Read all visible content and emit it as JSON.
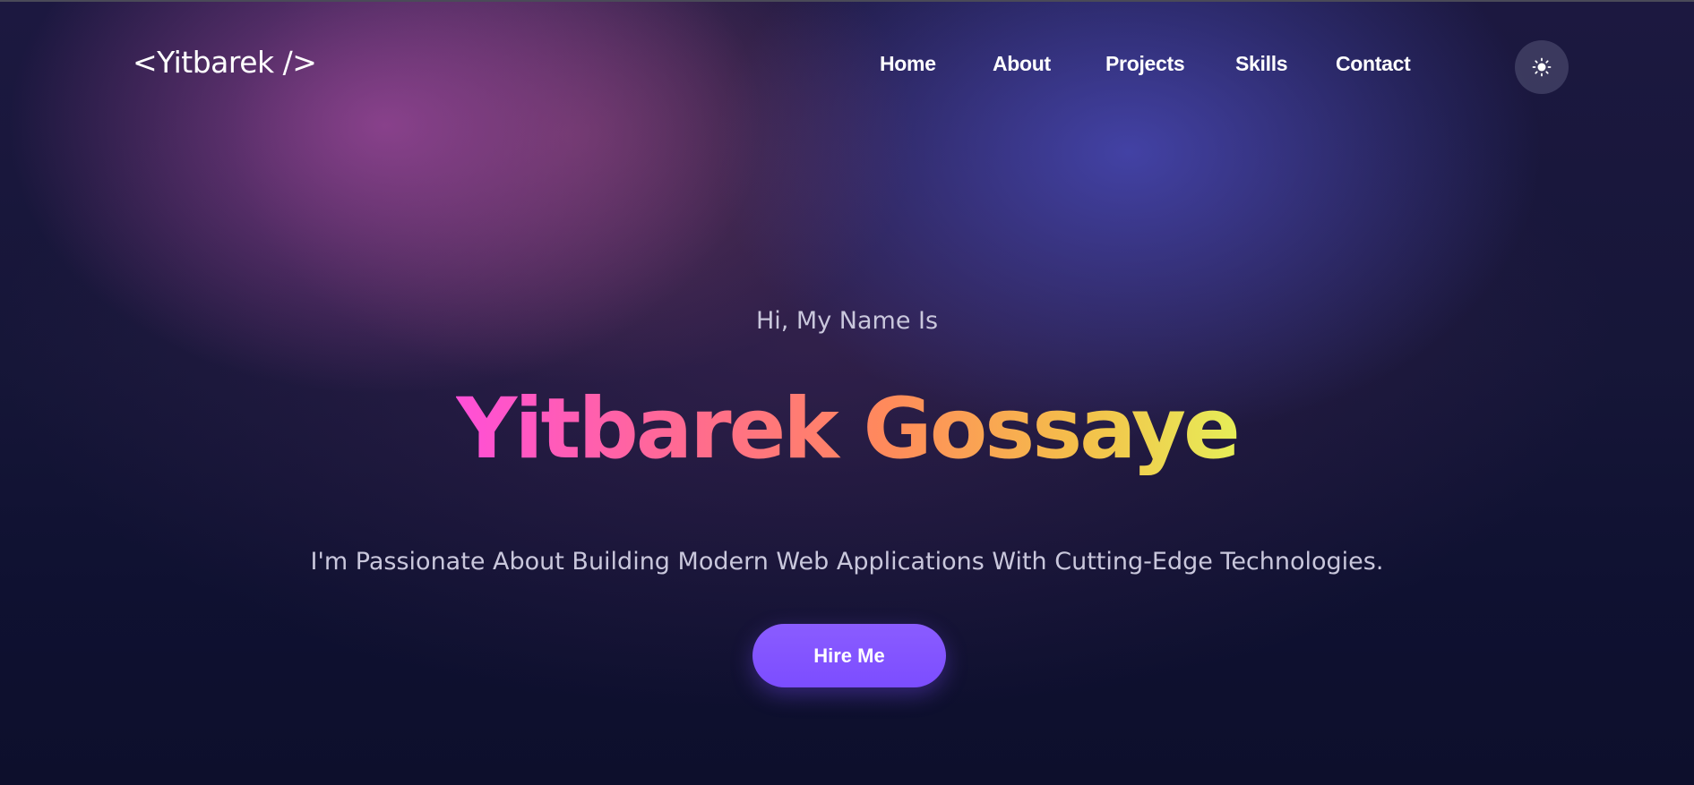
{
  "header": {
    "logo": "<Yitbarek />",
    "nav": [
      {
        "label": "Home"
      },
      {
        "label": "About"
      },
      {
        "label": "Projects"
      },
      {
        "label": "Skills"
      },
      {
        "label": "Contact"
      }
    ],
    "theme_toggle_icon": "sun-icon"
  },
  "hero": {
    "greeting": "Hi, My Name Is",
    "name": "Yitbarek Gossaye",
    "tagline": "I'm Passionate About Building Modern Web Applications With Cutting-Edge Technologies.",
    "cta_label": "Hire Me"
  },
  "colors": {
    "background": "#0e0f2e",
    "accent": "#7c4dff",
    "name_gradient_start": "#ff4fd8",
    "name_gradient_end": "#e6ee58",
    "muted_text": "#c9c7dc"
  }
}
